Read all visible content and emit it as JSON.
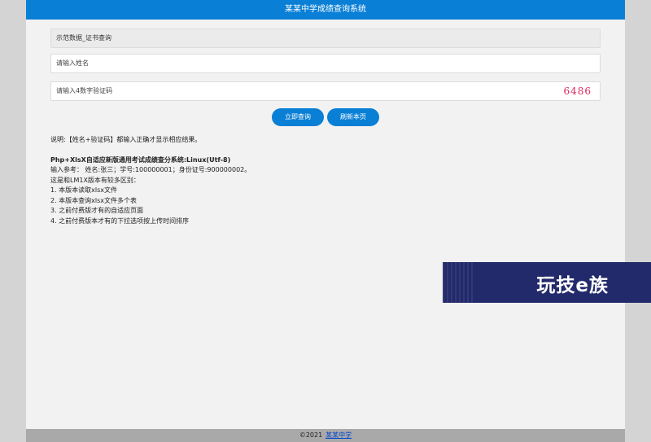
{
  "header": {
    "title": "某某中学成绩查询系统"
  },
  "form": {
    "dataset_select": "示范数据_证书查询",
    "name_placeholder": "请输入姓名",
    "code_placeholder": "请输入4数字验证码",
    "captcha": "6486"
  },
  "buttons": {
    "query": "立即查询",
    "refresh": "刷新本页"
  },
  "notes": {
    "hint": "说明:【姓名+验证码】都输入正确才显示相应结果。",
    "heading": "Php+XlsX自适应新版通用考试成绩查分系统:Linux(Utf-8)",
    "sample": "输入参考： 姓名:张三；学号:100000001；身份证号:900000002。",
    "diff": "这是和LM1X版本有较多区别：",
    "items": [
      "1. 本版本读取xlsx文件",
      "2. 本版本查询xlsx文件多个表",
      "3. 之前付费版才有的自适应页面",
      "4. 之前付费版本才有的下拉选项按上传时间排序"
    ]
  },
  "banner": {
    "text": "玩技e族"
  },
  "footer": {
    "copyright": "©2021",
    "link": "某某中学"
  },
  "colors": {
    "primary": "#0a7fd6",
    "captcha": "#e0245e",
    "banner": "#232a6b"
  }
}
